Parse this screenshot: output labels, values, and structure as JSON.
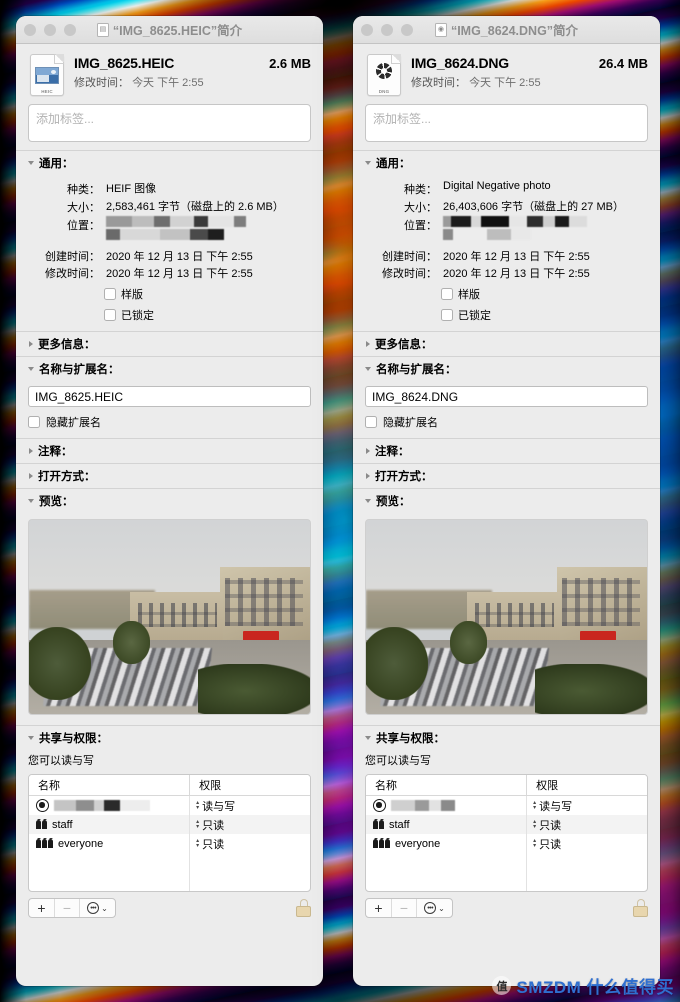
{
  "desktop": {
    "watermark_badge": "值",
    "watermark_text": "SMZDM 什么值得买"
  },
  "windows": [
    {
      "id": "heic",
      "title": "“IMG_8625.HEIC”简介",
      "titlebar_icon": "document-icon",
      "file_name": "IMG_8625.HEIC",
      "file_size": "2.6 MB",
      "modified_label": "修改时间：",
      "modified_value": "今天 下午 2:55",
      "tags_placeholder": "添加标签...",
      "sections": {
        "general": {
          "label": "通用：",
          "expanded": true,
          "kind_label": "种类：",
          "kind_value": "HEIF 图像",
          "size_label": "大小：",
          "size_value": "2,583,461 字节（磁盘上的 2.6 MB）",
          "location_label": "位置：",
          "location_value": "",
          "created_label": "创建时间：",
          "created_value": "2020 年 12 月 13 日 下午 2:55",
          "modified_label": "修改时间：",
          "modified_value": "2020 年 12 月 13 日 下午 2:55",
          "stationery_label": "样版",
          "stationery_checked": false,
          "locked_label": "已锁定",
          "locked_checked": false
        },
        "more_info": {
          "label": "更多信息：",
          "expanded": false
        },
        "name_ext": {
          "label": "名称与扩展名：",
          "expanded": true,
          "name_value": "IMG_8625.HEIC",
          "hide_ext_label": "隐藏扩展名",
          "hide_ext_checked": false
        },
        "comments": {
          "label": "注释：",
          "expanded": false
        },
        "open_with": {
          "label": "打开方式：",
          "expanded": false
        },
        "preview": {
          "label": "预览：",
          "expanded": true
        },
        "sharing": {
          "label": "共享与权限：",
          "expanded": true,
          "you_can": "您可以读与写",
          "columns": [
            "名称",
            "权限"
          ],
          "rows": [
            {
              "icon": "user-icon",
              "name": "",
              "redacted": true,
              "permission": "读与写"
            },
            {
              "icon": "group-icon",
              "name": "staff",
              "redacted": false,
              "permission": "只读"
            },
            {
              "icon": "group-icon",
              "name": "everyone",
              "redacted": false,
              "permission": "只读"
            }
          ],
          "add_label": "+",
          "remove_label": "−",
          "action_label": "⋯",
          "lock_state": "locked"
        }
      }
    },
    {
      "id": "dng",
      "title": "“IMG_8624.DNG”简介",
      "titlebar_icon": "aperture-icon",
      "file_name": "IMG_8624.DNG",
      "file_size": "26.4 MB",
      "modified_label": "修改时间：",
      "modified_value": "今天 下午 2:55",
      "tags_placeholder": "添加标签...",
      "sections": {
        "general": {
          "label": "通用：",
          "expanded": true,
          "kind_label": "种类：",
          "kind_value": "Digital Negative photo",
          "size_label": "大小：",
          "size_value": "26,403,606 字节（磁盘上的 27 MB）",
          "location_label": "位置：",
          "location_value": "",
          "created_label": "创建时间：",
          "created_value": "2020 年 12 月 13 日 下午 2:55",
          "modified_label": "修改时间：",
          "modified_value": "2020 年 12 月 13 日 下午 2:55",
          "stationery_label": "样版",
          "stationery_checked": false,
          "locked_label": "已锁定",
          "locked_checked": false
        },
        "more_info": {
          "label": "更多信息：",
          "expanded": false
        },
        "name_ext": {
          "label": "名称与扩展名：",
          "expanded": true,
          "name_value": "IMG_8624.DNG",
          "hide_ext_label": "隐藏扩展名",
          "hide_ext_checked": false
        },
        "comments": {
          "label": "注释：",
          "expanded": false
        },
        "open_with": {
          "label": "打开方式：",
          "expanded": false
        },
        "preview": {
          "label": "预览：",
          "expanded": true
        },
        "sharing": {
          "label": "共享与权限：",
          "expanded": true,
          "you_can": "您可以读与写",
          "columns": [
            "名称",
            "权限"
          ],
          "rows": [
            {
              "icon": "user-icon",
              "name": "",
              "redacted": true,
              "permission": "读与写"
            },
            {
              "icon": "group-icon",
              "name": "staff",
              "redacted": false,
              "permission": "只读"
            },
            {
              "icon": "group-icon",
              "name": "everyone",
              "redacted": false,
              "permission": "只读"
            }
          ],
          "add_label": "+",
          "remove_label": "−",
          "action_label": "⋯",
          "lock_state": "locked"
        }
      }
    }
  ]
}
